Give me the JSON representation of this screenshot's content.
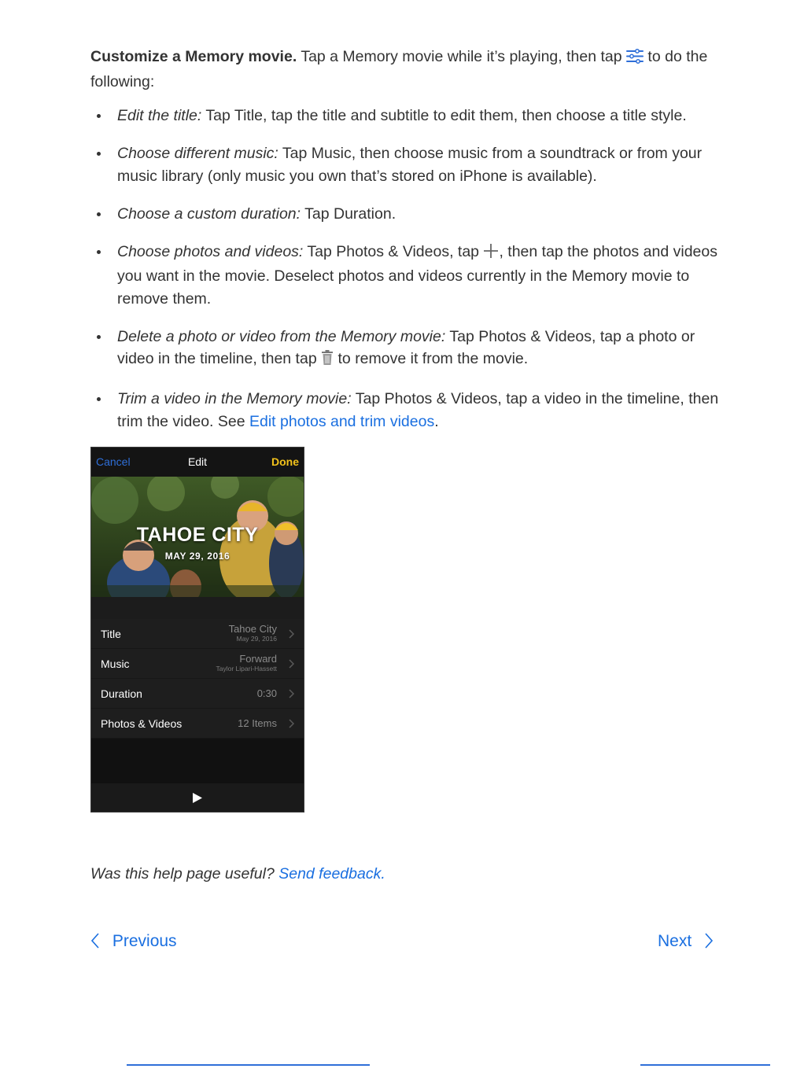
{
  "intro": {
    "lead": "Customize a Memory movie.",
    "text_before_icon": " Tap a Memory movie while it’s playing, then tap ",
    "text_after_icon": " to do the following:",
    "icon": "sliders-icon"
  },
  "bullets": [
    {
      "term": "Edit the title:",
      "text": " Tap Title, tap the title and subtitle to edit them, then choose a title style."
    },
    {
      "term": "Choose different music:",
      "text": " Tap Music, then choose music from a soundtrack or from your music library (only music you own that’s stored on iPhone is available)."
    },
    {
      "term": "Choose a custom duration:",
      "text": " Tap Duration."
    },
    {
      "term": "Choose photos and videos:",
      "text_before_icon": " Tap Photos & Videos, tap ",
      "icon": "plus-icon",
      "text_after_icon": ", then tap the photos and videos you want in the movie. Deselect photos and videos currently in the Memory movie to remove them."
    },
    {
      "term": "Delete a photo or video from the Memory movie:",
      "text_before_icon": " Tap Photos & Videos, tap a photo or video in the timeline, then tap ",
      "icon": "trash-icon",
      "text_after_icon": " to remove it from the movie."
    },
    {
      "term": "Trim a video in the Memory movie:",
      "text": " Tap Photos & Videos, tap a video in the timeline, then trim the video. See ",
      "link": "Edit photos and trim videos",
      "text_end": "."
    }
  ],
  "phone": {
    "cancel": "Cancel",
    "title": "Edit",
    "done": "Done",
    "photo_title": "TAHOE CITY",
    "photo_date": "MAY 29, 2016",
    "rows": [
      {
        "label": "Title",
        "value": "Tahoe City",
        "sub": "May 29, 2016"
      },
      {
        "label": "Music",
        "value": "Forward",
        "sub": "Taylor Lipari-Hassett"
      },
      {
        "label": "Duration",
        "value": "0:30"
      },
      {
        "label": "Photos & Videos",
        "value": "12 Items"
      }
    ]
  },
  "feedback": {
    "question": "Was this help page useful? ",
    "link": "Send feedback."
  },
  "nav": {
    "previous": "Previous",
    "next": "Next"
  },
  "colors": {
    "link": "#1a6fe0",
    "done": "#f2c21b",
    "cancel": "#2f6fd8"
  }
}
